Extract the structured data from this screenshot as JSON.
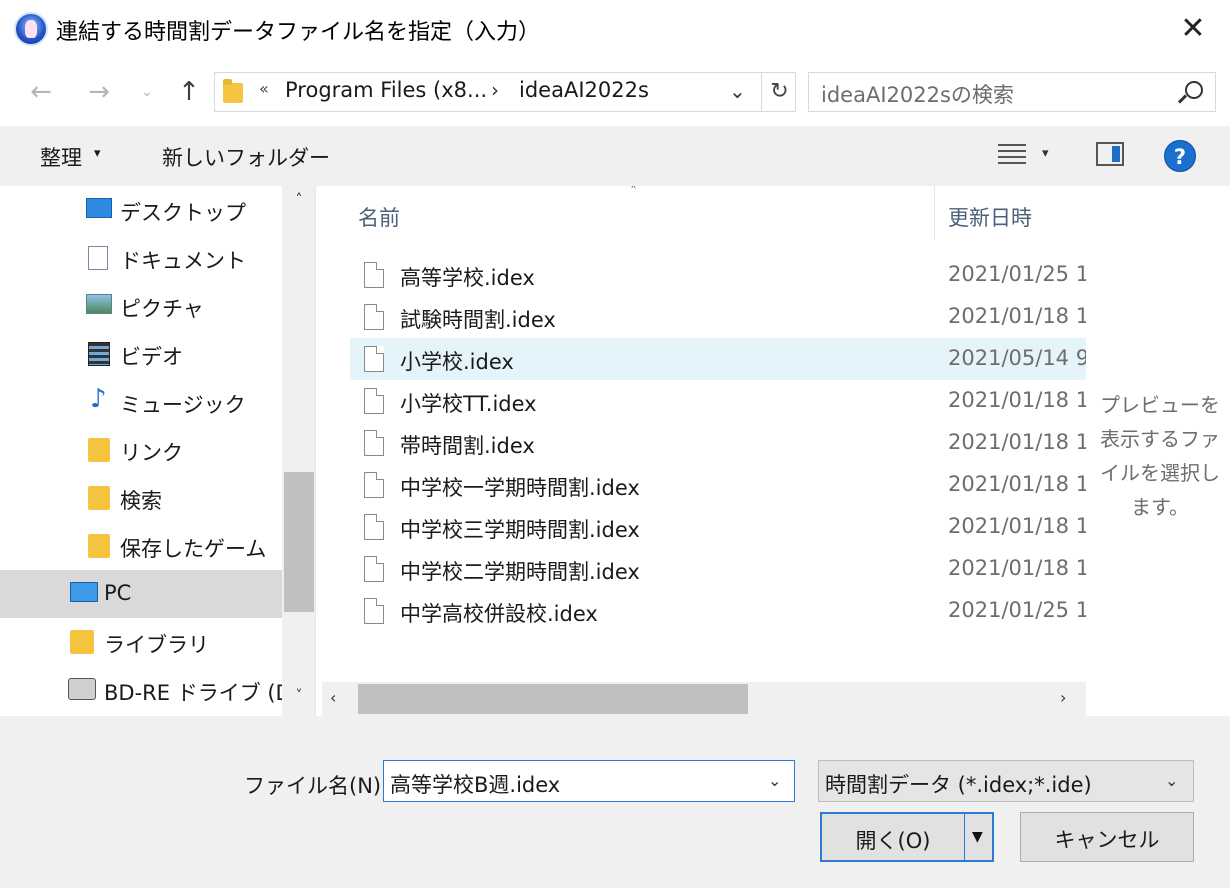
{
  "window": {
    "title": "連結する時間割データファイル名を指定（入力）",
    "close_glyph": "✕"
  },
  "nav": {
    "back_glyph": "←",
    "forward_glyph": "→",
    "recent_glyph": "⌄",
    "up_glyph": "↑",
    "address": {
      "overflow_glyph": "«",
      "crumbs": [
        "Program Files (x8...",
        "ideaAI2022s"
      ],
      "separator_glyph": "›",
      "dropdown_glyph": "⌄",
      "refresh_glyph": "↻"
    },
    "search": {
      "placeholder": "ideaAI2022sの検索"
    }
  },
  "toolbar": {
    "organize_label": "整理",
    "organize_chevron": "▾",
    "new_folder_label": "新しいフォルダー",
    "view_chevron": "▾",
    "help_label": "?"
  },
  "sidebar": {
    "items": [
      {
        "label": "デスクトップ",
        "icon": "desktop-icon",
        "selected": false
      },
      {
        "label": "ドキュメント",
        "icon": "document-icon",
        "selected": false
      },
      {
        "label": "ピクチャ",
        "icon": "pictures-icon",
        "selected": false
      },
      {
        "label": "ビデオ",
        "icon": "video-icon",
        "selected": false
      },
      {
        "label": "ミュージック",
        "icon": "music-icon",
        "selected": false
      },
      {
        "label": "リンク",
        "icon": "links-icon",
        "selected": false
      },
      {
        "label": "検索",
        "icon": "search-folder-icon",
        "selected": false
      },
      {
        "label": "保存したゲーム",
        "icon": "saved-games-icon",
        "selected": false
      },
      {
        "label": "PC",
        "icon": "pc-icon",
        "selected": true
      },
      {
        "label": "ライブラリ",
        "icon": "library-icon",
        "selected": false
      },
      {
        "label": "BD-RE ドライブ (D:",
        "icon": "bd-drive-icon",
        "selected": false
      }
    ],
    "scroll_up_glyph": "˄",
    "scroll_down_glyph": "˅"
  },
  "file_list": {
    "sort_glyph": "˄",
    "columns": {
      "name": "名前",
      "date": "更新日時"
    },
    "files": [
      {
        "name": "高等学校.idex",
        "date": "2021/01/25 1",
        "selected": false
      },
      {
        "name": "試験時間割.idex",
        "date": "2021/01/18 1",
        "selected": false
      },
      {
        "name": "小学校.idex",
        "date": "2021/05/14 9",
        "selected": true
      },
      {
        "name": "小学校TT.idex",
        "date": "2021/01/18 1",
        "selected": false
      },
      {
        "name": "帯時間割.idex",
        "date": "2021/01/18 1",
        "selected": false
      },
      {
        "name": "中学校一学期時間割.idex",
        "date": "2021/01/18 1",
        "selected": false
      },
      {
        "name": "中学校三学期時間割.idex",
        "date": "2021/01/18 1",
        "selected": false
      },
      {
        "name": "中学校二学期時間割.idex",
        "date": "2021/01/18 1",
        "selected": false
      },
      {
        "name": "中学高校併設校.idex",
        "date": "2021/01/25 1",
        "selected": false
      }
    ],
    "hscroll_left_glyph": "‹",
    "hscroll_right_glyph": "›"
  },
  "preview": {
    "message": "プレビューを表示するファイルを選択します。"
  },
  "footer": {
    "filename_label": "ファイル名(N):",
    "filename_value": "高等学校B週.idex",
    "filename_chevron": "⌄",
    "filetype_value": "時間割データ (*.idex;*.ide)",
    "filetype_chevron": "⌄",
    "open_label": "開く(O)",
    "open_split_glyph": "▼",
    "cancel_label": "キャンセル"
  },
  "colors": {
    "accent": "#2b7bd6",
    "selection": "#e5f3fb",
    "nav_selection": "#d9d9d9",
    "help": "#1a6fd1"
  }
}
